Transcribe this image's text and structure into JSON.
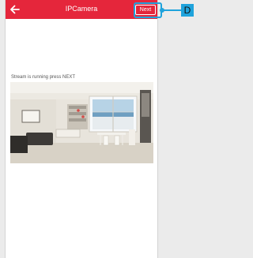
{
  "topbar": {
    "title": "IPCamera",
    "next_label": "Next"
  },
  "main": {
    "status": "Stream is running press NEXT"
  },
  "callout": {
    "label": "D"
  },
  "colors": {
    "header": "#e5263b",
    "accent": "#1fa3dc"
  },
  "icons": {
    "back": "left-arrow-icon"
  }
}
